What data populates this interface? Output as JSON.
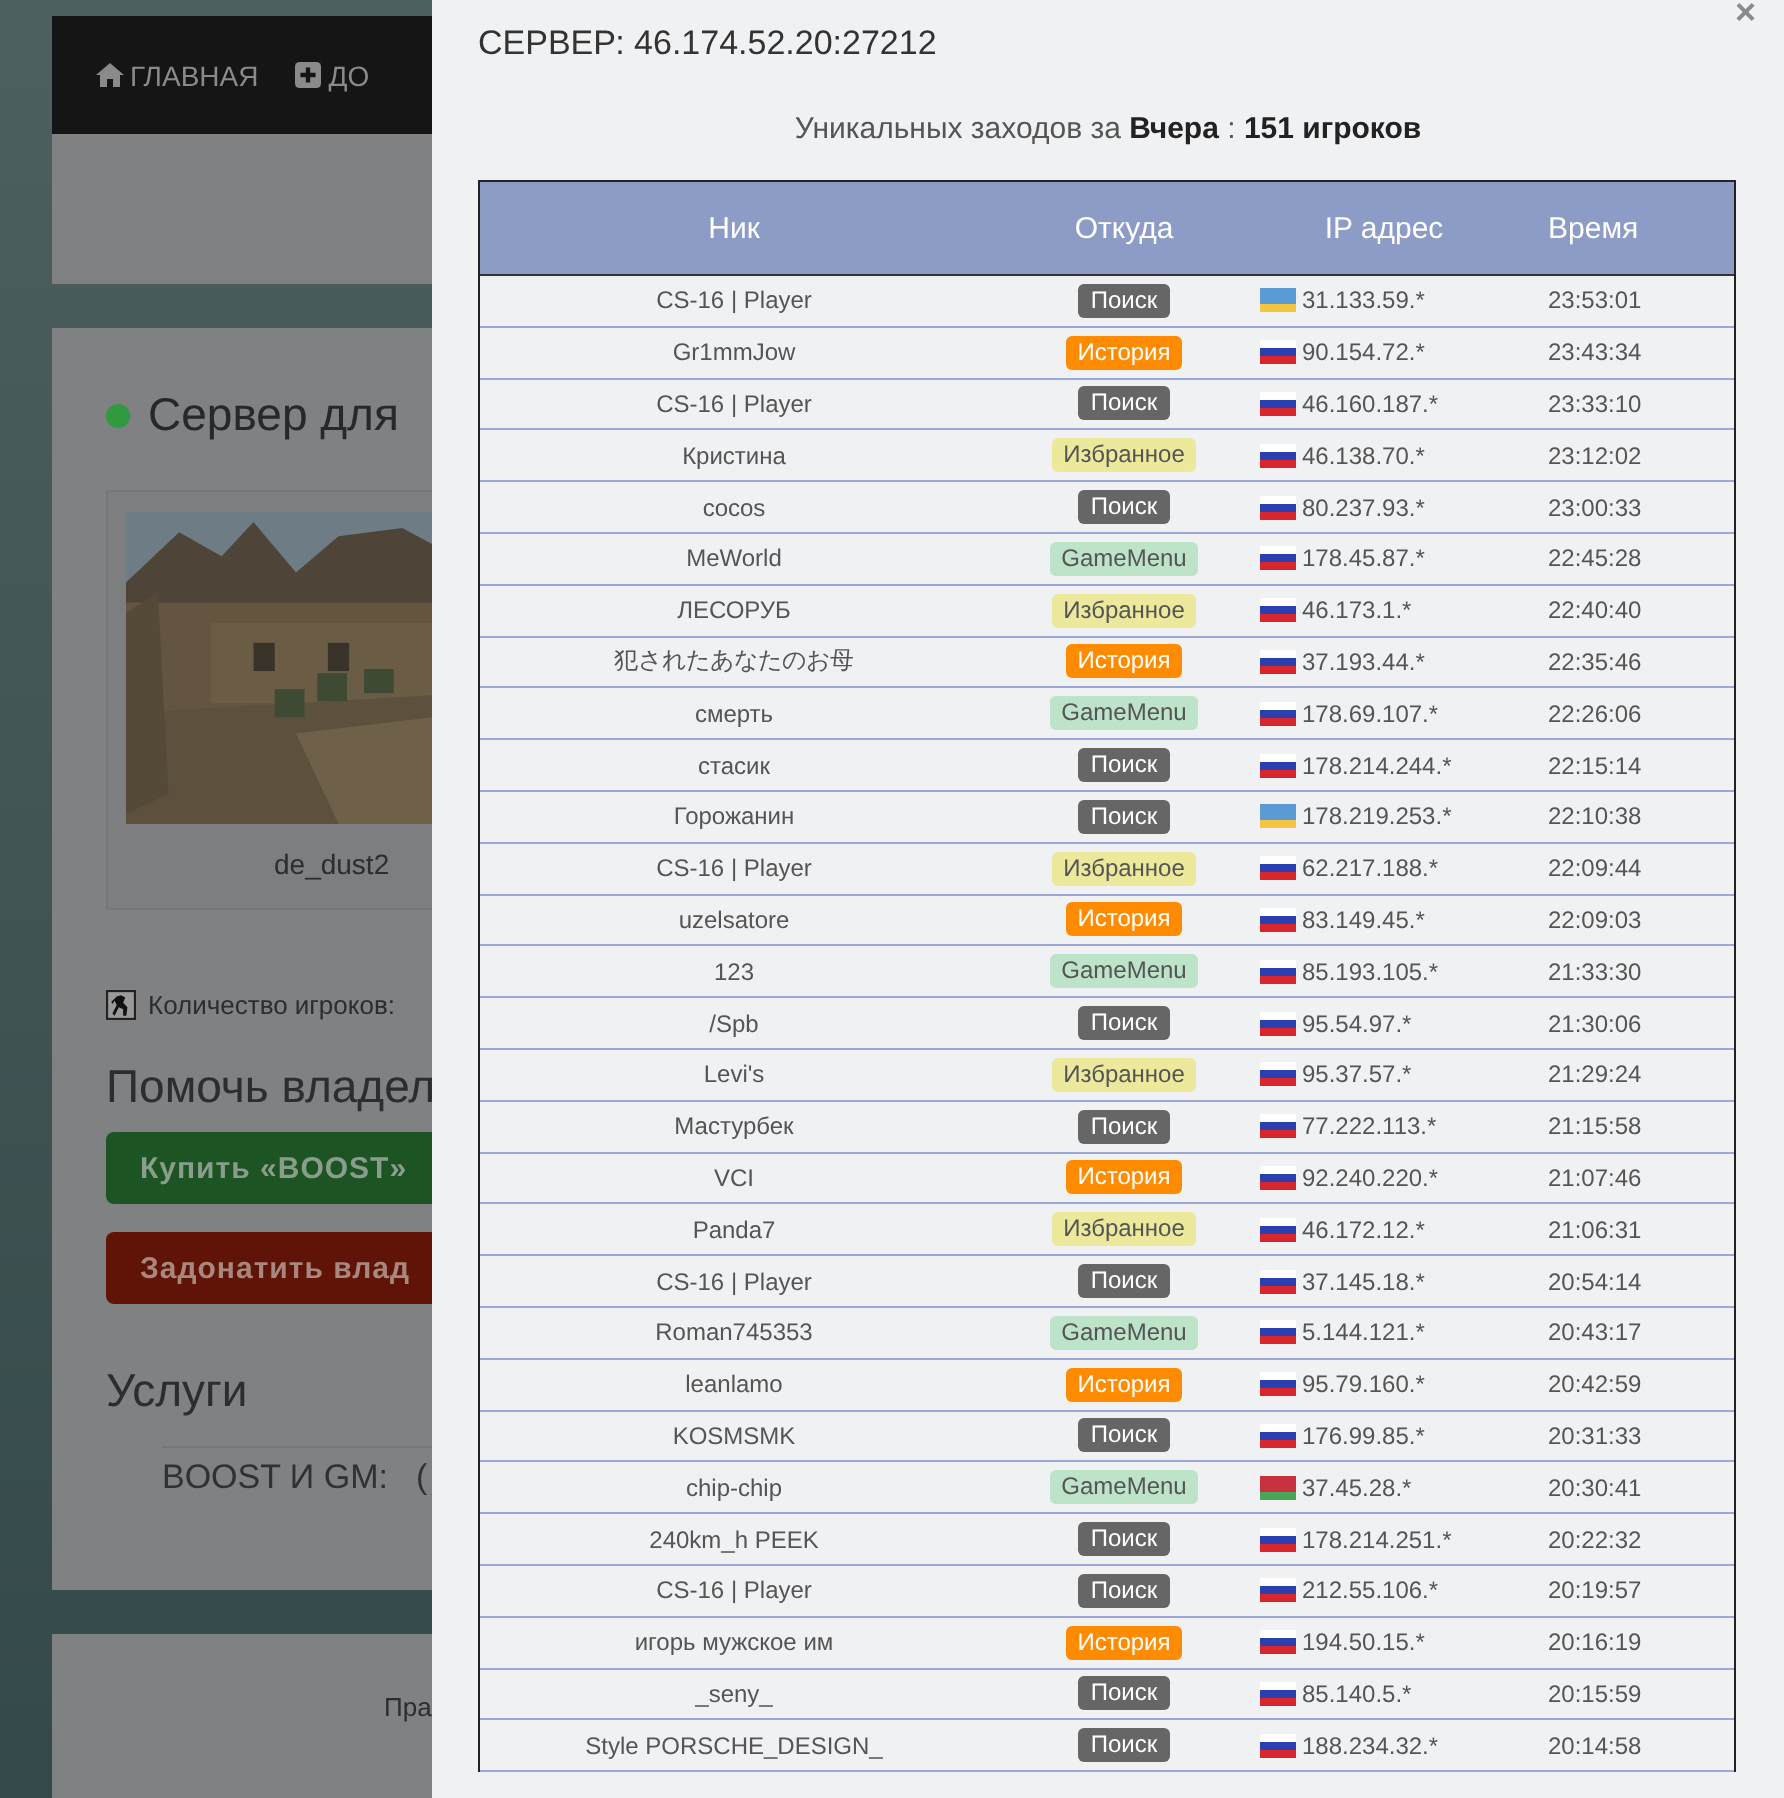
{
  "background_page": {
    "nav": [
      {
        "label": "ГЛАВНАЯ",
        "kind": "home"
      },
      {
        "label": "ДО",
        "kind": "plus"
      }
    ],
    "server_title": "Сервер для",
    "map_caption": "de_dust2",
    "players_label": "Количество игроков:",
    "help_heading": "Помочь владел",
    "buttons": [
      {
        "label": "Купить «BOOST»",
        "kind": "boost"
      },
      {
        "label": "Задонатить влад",
        "kind": "donate"
      }
    ],
    "services_heading": "Услуги",
    "services_label": "BOOST И GM:",
    "services_value": "(",
    "footer_text": "Пра"
  },
  "modal": {
    "title": "СЕРВЕР: 46.174.52.20:27212",
    "close": "×",
    "summary": "Уникальных заходов за **Вчера** : **151 игроков**",
    "table": {
      "columns": [
        "Ник",
        "Откуда",
        "IP адрес",
        "Время"
      ],
      "rows": [
        {
          "nick": "CS-16 | Player",
          "source": {
            "label": "Поиск",
            "kind": "search"
          },
          "flag": {
            "kind": "ua"
          },
          "ip": "31.133.59.*",
          "time": "23:53:01"
        },
        {
          "nick": "Gr1mmJow",
          "source": {
            "label": "История",
            "kind": "history"
          },
          "flag": {
            "kind": "ru"
          },
          "ip": "90.154.72.*",
          "time": "23:43:34"
        },
        {
          "nick": "CS-16 | Player",
          "source": {
            "label": "Поиск",
            "kind": "search"
          },
          "flag": {
            "kind": "ru"
          },
          "ip": "46.160.187.*",
          "time": "23:33:10"
        },
        {
          "nick": "Кристина",
          "source": {
            "label": "Избранное",
            "kind": "favorites"
          },
          "flag": {
            "kind": "ru"
          },
          "ip": "46.138.70.*",
          "time": "23:12:02"
        },
        {
          "nick": "cocos",
          "source": {
            "label": "Поиск",
            "kind": "search"
          },
          "flag": {
            "kind": "ru"
          },
          "ip": "80.237.93.*",
          "time": "23:00:33"
        },
        {
          "nick": "MeWorld",
          "source": {
            "label": "GameMenu",
            "kind": "gamemenu"
          },
          "flag": {
            "kind": "ru"
          },
          "ip": "178.45.87.*",
          "time": "22:45:28"
        },
        {
          "nick": "ЛЕСОРУБ",
          "source": {
            "label": "Избранное",
            "kind": "favorites"
          },
          "flag": {
            "kind": "ru"
          },
          "ip": "46.173.1.*",
          "time": "22:40:40"
        },
        {
          "nick": "犯されたあなたのお母",
          "source": {
            "label": "История",
            "kind": "history"
          },
          "flag": {
            "kind": "ru"
          },
          "ip": "37.193.44.*",
          "time": "22:35:46"
        },
        {
          "nick": "смерть",
          "source": {
            "label": "GameMenu",
            "kind": "gamemenu"
          },
          "flag": {
            "kind": "ru"
          },
          "ip": "178.69.107.*",
          "time": "22:26:06"
        },
        {
          "nick": "стасик",
          "source": {
            "label": "Поиск",
            "kind": "search"
          },
          "flag": {
            "kind": "ru"
          },
          "ip": "178.214.244.*",
          "time": "22:15:14"
        },
        {
          "nick": "Горожанин",
          "source": {
            "label": "Поиск",
            "kind": "search"
          },
          "flag": {
            "kind": "ua"
          },
          "ip": "178.219.253.*",
          "time": "22:10:38"
        },
        {
          "nick": "CS-16 | Player",
          "source": {
            "label": "Избранное",
            "kind": "favorites"
          },
          "flag": {
            "kind": "ru"
          },
          "ip": "62.217.188.*",
          "time": "22:09:44"
        },
        {
          "nick": "uzelsatore",
          "source": {
            "label": "История",
            "kind": "history"
          },
          "flag": {
            "kind": "ru"
          },
          "ip": "83.149.45.*",
          "time": "22:09:03"
        },
        {
          "nick": "123",
          "source": {
            "label": "GameMenu",
            "kind": "gamemenu"
          },
          "flag": {
            "kind": "ru"
          },
          "ip": "85.193.105.*",
          "time": "21:33:30"
        },
        {
          "nick": "/Spb",
          "source": {
            "label": "Поиск",
            "kind": "search"
          },
          "flag": {
            "kind": "ru"
          },
          "ip": "95.54.97.*",
          "time": "21:30:06"
        },
        {
          "nick": "Levi's",
          "source": {
            "label": "Избранное",
            "kind": "favorites"
          },
          "flag": {
            "kind": "ru"
          },
          "ip": "95.37.57.*",
          "time": "21:29:24"
        },
        {
          "nick": "Мастурбек",
          "source": {
            "label": "Поиск",
            "kind": "search"
          },
          "flag": {
            "kind": "ru"
          },
          "ip": "77.222.113.*",
          "time": "21:15:58"
        },
        {
          "nick": "VCI",
          "source": {
            "label": "История",
            "kind": "history"
          },
          "flag": {
            "kind": "ru"
          },
          "ip": "92.240.220.*",
          "time": "21:07:46"
        },
        {
          "nick": "Panda7",
          "source": {
            "label": "Избранное",
            "kind": "favorites"
          },
          "flag": {
            "kind": "ru"
          },
          "ip": "46.172.12.*",
          "time": "21:06:31"
        },
        {
          "nick": "CS-16 | Player",
          "source": {
            "label": "Поиск",
            "kind": "search"
          },
          "flag": {
            "kind": "ru"
          },
          "ip": "37.145.18.*",
          "time": "20:54:14"
        },
        {
          "nick": "Roman745353",
          "source": {
            "label": "GameMenu",
            "kind": "gamemenu"
          },
          "flag": {
            "kind": "ru"
          },
          "ip": "5.144.121.*",
          "time": "20:43:17"
        },
        {
          "nick": "leanlamo",
          "source": {
            "label": "История",
            "kind": "history"
          },
          "flag": {
            "kind": "ru"
          },
          "ip": "95.79.160.*",
          "time": "20:42:59"
        },
        {
          "nick": "KOSMSMK",
          "source": {
            "label": "Поиск",
            "kind": "search"
          },
          "flag": {
            "kind": "ru"
          },
          "ip": "176.99.85.*",
          "time": "20:31:33"
        },
        {
          "nick": "chip-chip",
          "source": {
            "label": "GameMenu",
            "kind": "gamemenu"
          },
          "flag": {
            "kind": "by"
          },
          "ip": "37.45.28.*",
          "time": "20:30:41"
        },
        {
          "nick": "240km_h PEEK",
          "source": {
            "label": "Поиск",
            "kind": "search"
          },
          "flag": {
            "kind": "ru"
          },
          "ip": "178.214.251.*",
          "time": "20:22:32"
        },
        {
          "nick": "CS-16 | Player",
          "source": {
            "label": "Поиск",
            "kind": "search"
          },
          "flag": {
            "kind": "ru"
          },
          "ip": "212.55.106.*",
          "time": "20:19:57"
        },
        {
          "nick": "игорь мужское им",
          "source": {
            "label": "История",
            "kind": "history"
          },
          "flag": {
            "kind": "ru"
          },
          "ip": "194.50.15.*",
          "time": "20:16:19"
        },
        {
          "nick": "_seny_",
          "source": {
            "label": "Поиск",
            "kind": "search"
          },
          "flag": {
            "kind": "ru"
          },
          "ip": "85.140.5.*",
          "time": "20:15:59"
        },
        {
          "nick": "Style PORSCHE_DESIGN_",
          "source": {
            "label": "Поиск",
            "kind": "search"
          },
          "flag": {
            "kind": "ru"
          },
          "ip": "188.234.32.*",
          "time": "20:14:58"
        }
      ]
    }
  }
}
